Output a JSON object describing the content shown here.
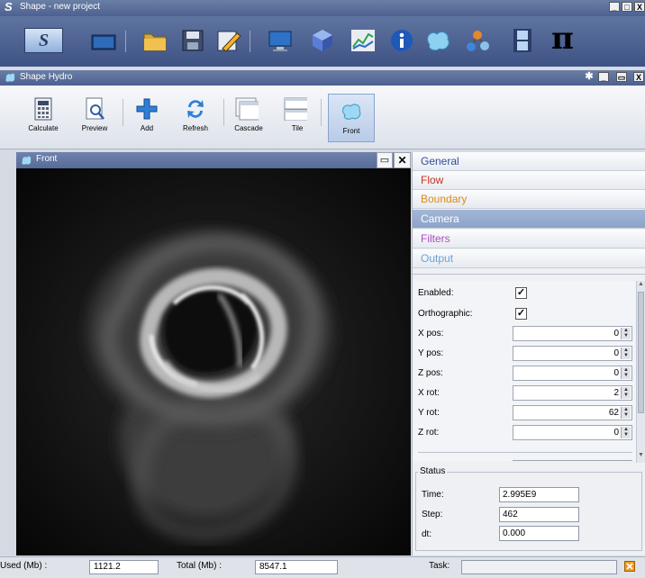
{
  "app": {
    "title": "Shape - new project",
    "logo_letter": "S",
    "controls": [
      "_",
      "□",
      "X"
    ]
  },
  "main_toolbar": {
    "icons": [
      "shape-logo-icon",
      "screen-icon",
      "folder-icon",
      "save-icon",
      "edit-icon",
      "monitor-icon",
      "cube-icon",
      "chart-icon",
      "info-icon",
      "splash-icon",
      "molecule-icon",
      "film-icon",
      "pi-icon"
    ],
    "pi_symbol": "π"
  },
  "subwindow": {
    "title": "Shape Hydro",
    "controls": [
      "✱",
      "_",
      "▭",
      "X"
    ]
  },
  "ribbon": {
    "buttons": [
      {
        "label": "Calculate",
        "icon": "calculator-icon"
      },
      {
        "label": "Preview",
        "icon": "preview-icon"
      },
      {
        "label": "Add",
        "icon": "add-icon"
      },
      {
        "label": "Refresh",
        "icon": "refresh-icon"
      },
      {
        "label": "Cascade",
        "icon": "cascade-icon"
      },
      {
        "label": "Tile",
        "icon": "tile-icon"
      },
      {
        "label": "Front",
        "icon": "front-icon"
      }
    ]
  },
  "viewport": {
    "title": "Front",
    "controls": [
      "▭",
      "✕"
    ]
  },
  "panel": {
    "headers": [
      {
        "label": "General",
        "color": "#2f4f9b"
      },
      {
        "label": "Flow",
        "color": "#c8331f"
      },
      {
        "label": "Boundary",
        "color": "#d98a1c"
      },
      {
        "label": "Camera",
        "color": "#ffffff"
      },
      {
        "label": "Filters",
        "color": "#b04ac5"
      },
      {
        "label": "Output",
        "color": "#6aa3d8"
      }
    ],
    "camera": {
      "enabled_label": "Enabled:",
      "enabled": "✓",
      "ortho_label": "Orthographic:",
      "ortho": "✓",
      "fields": [
        {
          "label": "X pos:",
          "value": "0"
        },
        {
          "label": "Y pos:",
          "value": "0"
        },
        {
          "label": "Z pos:",
          "value": "0"
        },
        {
          "label": "X rot:",
          "value": "2"
        },
        {
          "label": "Y rot:",
          "value": "62"
        },
        {
          "label": "Z rot:",
          "value": "0"
        }
      ]
    },
    "status": {
      "title": "Status",
      "time_label": "Time:",
      "time": "2.995E9",
      "step_label": "Step:",
      "step": "462",
      "dt_label": "dt:",
      "dt": "0.000"
    }
  },
  "statusbar": {
    "used_label": "Used (Mb) :",
    "used": "1121.2",
    "total_label": "Total (Mb) :",
    "total": "8547.1",
    "task_label": "Task:",
    "task": ""
  }
}
